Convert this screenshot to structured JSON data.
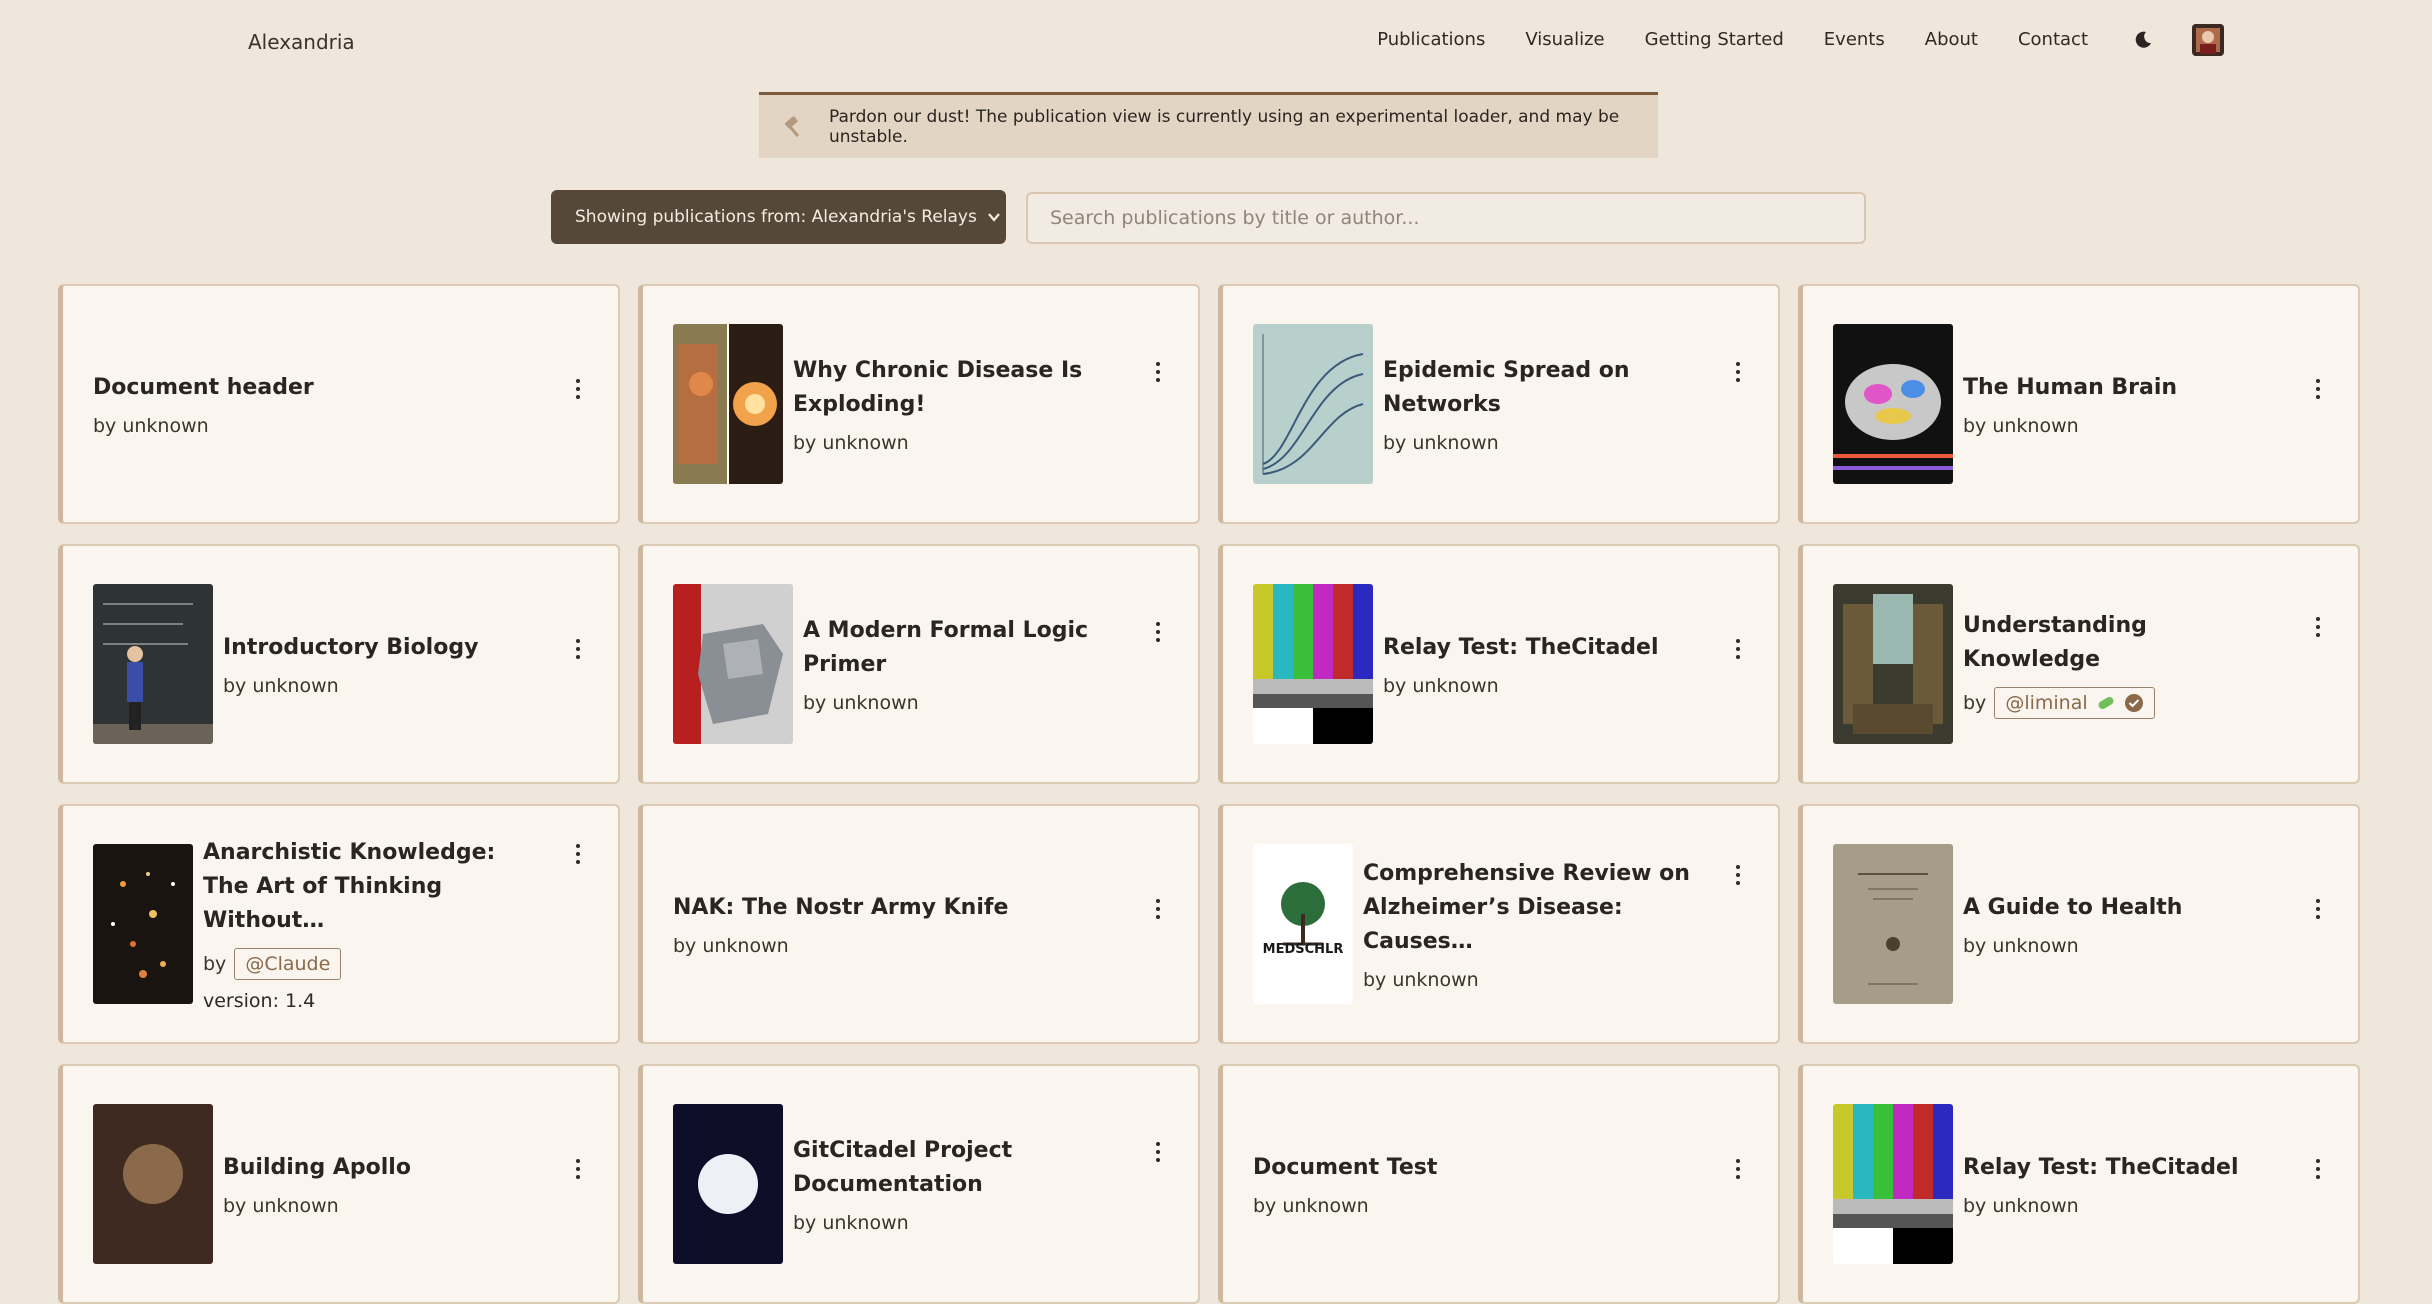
{
  "nav": {
    "brand": "Alexandria",
    "links": [
      "Publications",
      "Visualize",
      "Getting Started",
      "Events",
      "About",
      "Contact"
    ],
    "theme_icon": "moon-icon",
    "avatar_icon": "user-avatar"
  },
  "notice": {
    "icon": "hammer-icon",
    "text": "Pardon our dust! The publication view is currently using an experimental loader, and may be unstable."
  },
  "filter": {
    "label": "Showing publications from: Alexandria's Relays",
    "icon": "chevron-down-icon"
  },
  "search": {
    "placeholder": "Search publications by title or author...",
    "value": ""
  },
  "colors": {
    "background": "#efe6dc",
    "card": "#faf5ef",
    "card_border": "#dccab5",
    "button": "#554839",
    "badge_text": "#8a6a49"
  },
  "cards": [
    {
      "title": "Document header",
      "by": "by",
      "author": "unknown",
      "author_badge": false,
      "version": null,
      "thumb": null
    },
    {
      "title": "Why Chronic Disease Is Exploding!",
      "by": "by",
      "author": "unknown",
      "author_badge": false,
      "version": null,
      "thumb": "split-fire"
    },
    {
      "title": "Epidemic Spread on Networks",
      "by": "by",
      "author": "unknown",
      "author_badge": false,
      "version": null,
      "thumb": "chart-paper"
    },
    {
      "title": "The Human Brain",
      "by": "by",
      "author": "unknown",
      "author_badge": false,
      "version": null,
      "thumb": "brain"
    },
    {
      "title": "Introductory Biology",
      "by": "by",
      "author": "unknown",
      "author_badge": false,
      "version": null,
      "thumb": "lecture"
    },
    {
      "title": "A Modern Formal Logic Primer",
      "by": "by",
      "author": "unknown",
      "author_badge": false,
      "version": null,
      "thumb": "puzzle"
    },
    {
      "title": "Relay Test: TheCitadel",
      "by": "by",
      "author": "unknown",
      "author_badge": false,
      "version": null,
      "thumb": "color-bars"
    },
    {
      "title": "Understanding Knowledge",
      "by": "by",
      "author": "@liminal",
      "author_badge": true,
      "badge_icons": [
        "pill-icon",
        "verified-icon"
      ],
      "version": null,
      "thumb": "library"
    },
    {
      "title": "Anarchistic Knowledge: The Art of Thinking Without…",
      "by": "by",
      "author": "@Claude",
      "author_badge": true,
      "badge_icons": [],
      "version": "version: 1.4",
      "thumb": "sparks"
    },
    {
      "title": "NAK: The Nostr Army Knife",
      "by": "by",
      "author": "unknown",
      "author_badge": false,
      "version": null,
      "thumb": null
    },
    {
      "title": "Comprehensive Review on Alzheimer’s Disease: Causes…",
      "by": "by",
      "author": "unknown",
      "author_badge": false,
      "version": null,
      "thumb": "medschlr",
      "thumb_text": "MEDSCHLR"
    },
    {
      "title": "A Guide to Health",
      "by": "by",
      "author": "unknown",
      "author_badge": false,
      "version": null,
      "thumb": "old-book"
    },
    {
      "title": "Building Apollo",
      "by": "by",
      "author": "unknown",
      "author_badge": false,
      "version": null,
      "thumb": "brown-logo"
    },
    {
      "title": "GitCitadel Project Documentation",
      "by": "by",
      "author": "unknown",
      "author_badge": false,
      "version": null,
      "thumb": "dark-circle"
    },
    {
      "title": "Document Test",
      "by": "by",
      "author": "unknown",
      "author_badge": false,
      "version": null,
      "thumb": null
    },
    {
      "title": "Relay Test: TheCitadel",
      "by": "by",
      "author": "unknown",
      "author_badge": false,
      "version": null,
      "thumb": "color-bars"
    }
  ]
}
